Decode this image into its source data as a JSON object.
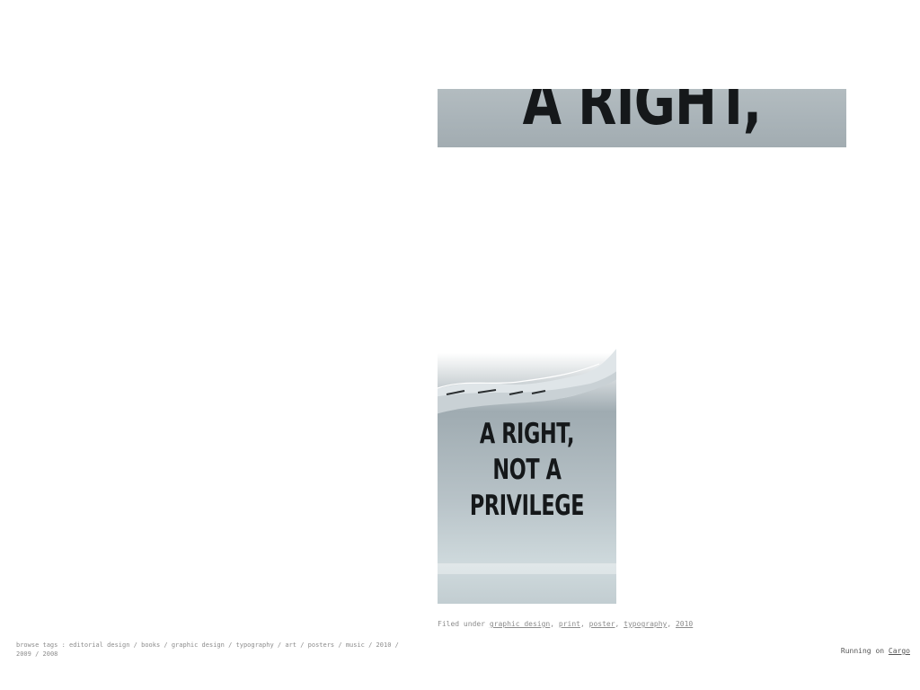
{
  "top_image": {
    "visible_text": "A RIGHT,"
  },
  "poster_image": {
    "lines": [
      "A RIGHT,",
      "NOT A",
      "PRIVILEGE"
    ]
  },
  "filed_under": {
    "prefix": "Filed under",
    "tags": [
      "graphic design",
      "print",
      "poster",
      "typography",
      "2010"
    ]
  },
  "browse_tags": {
    "prefix": "browse tags :",
    "separator": "/",
    "items": [
      "editorial design",
      "books",
      "graphic design",
      "typography",
      "art",
      "posters",
      "music",
      "2010",
      "2009",
      "2008"
    ]
  },
  "footer": {
    "running_on_label": "Running on",
    "cargo_link": "Cargo"
  },
  "colors": {
    "text_gray": "#8c8c8c",
    "poster_ink": "#15181a",
    "image_blue_gray": "#a9b3b8"
  }
}
